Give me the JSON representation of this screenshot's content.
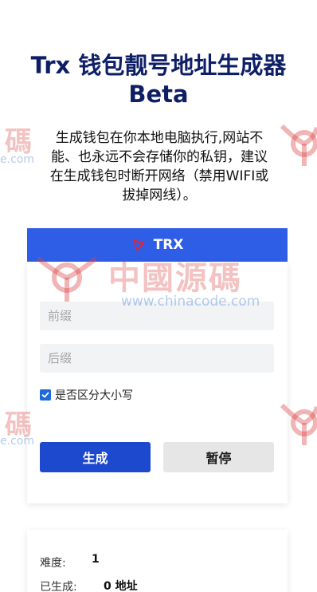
{
  "header": {
    "title_line1": "Trx 钱包靓号地址生成器",
    "title_line2": "Beta",
    "subtitle": "生成钱包在你本地电脑执行,网站不能、也永远不会存储你的私钥，建议在生成钱包时断开网络（禁用WIFI或拔掉网线）。"
  },
  "tab": {
    "label": "TRX",
    "icon": "tron-logo-icon",
    "color": "#2f5ee6"
  },
  "form": {
    "prefix_placeholder": "前缀",
    "suffix_placeholder": "后缀",
    "case_sensitive_label": "是否区分大小写",
    "case_sensitive_checked": true,
    "generate_label": "生成",
    "pause_label": "暂停"
  },
  "stats": {
    "difficulty_label": "难度:",
    "difficulty_value": "1",
    "generated_label": "已生成:",
    "generated_value": "0 地址"
  },
  "watermark": {
    "brand_text": "中國源碼",
    "url": "www.chinacode.com",
    "left_text": "碼",
    "left_url": "e.com"
  },
  "colors": {
    "title": "#0f1f66",
    "primary": "#1d49cf",
    "secondary": "#e6e6e6"
  }
}
